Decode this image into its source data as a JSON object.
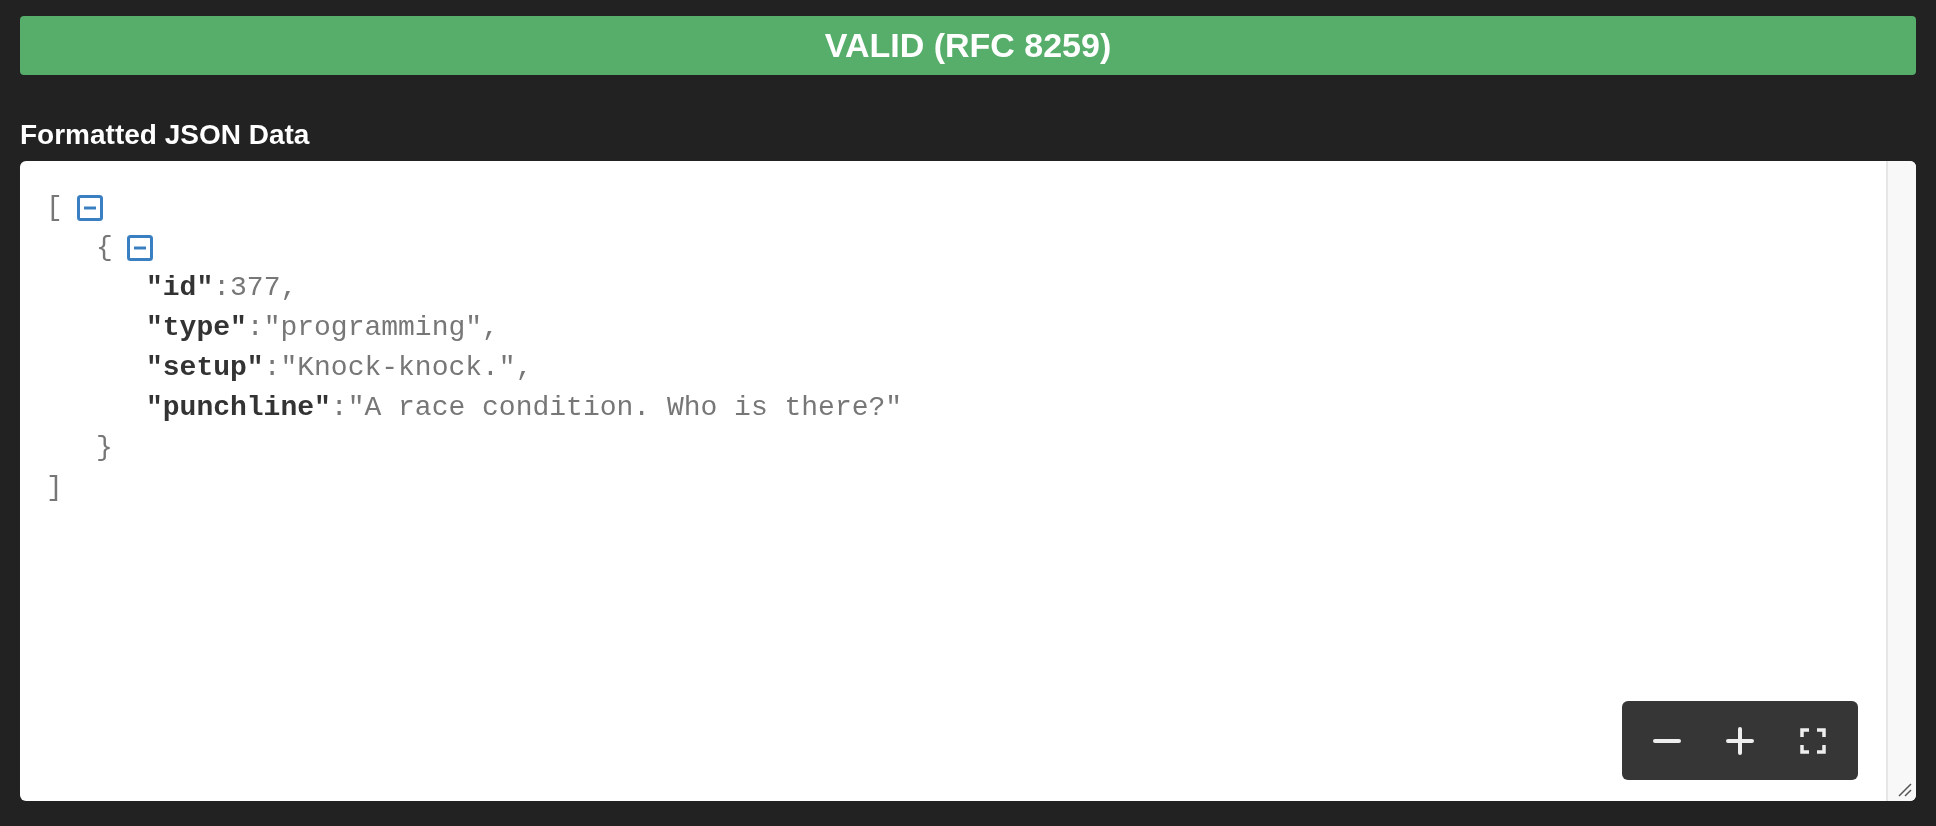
{
  "status_banner": {
    "text": "VALID (RFC 8259)"
  },
  "heading": "Formatted JSON Data",
  "json_tree": {
    "open": "[",
    "close": "]",
    "expanded": true,
    "children": [
      {
        "open": "{",
        "close": "}",
        "expanded": true,
        "properties": [
          {
            "key": "\"id\"",
            "separator": ":",
            "value": "377",
            "trailing": ","
          },
          {
            "key": "\"type\"",
            "separator": ":",
            "value": "\"programming\"",
            "trailing": ","
          },
          {
            "key": "\"setup\"",
            "separator": ":",
            "value": "\"Knock-knock.\"",
            "trailing": ","
          },
          {
            "key": "\"punchline\"",
            "separator": ":",
            "value": "\"A race condition. Who is there?\""
          }
        ]
      }
    ]
  },
  "zoom_controls": [
    {
      "kind": "zoom-out"
    },
    {
      "kind": "zoom-in"
    },
    {
      "kind": "fullscreen"
    }
  ]
}
